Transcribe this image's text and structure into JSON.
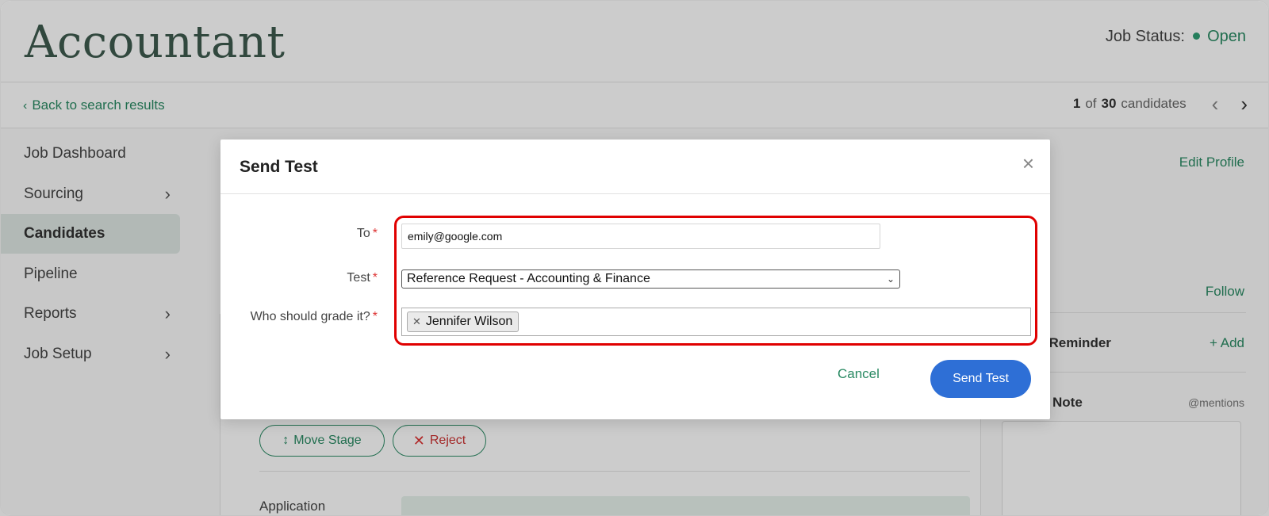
{
  "header": {
    "job_title": "Accountant",
    "status_label": "Job Status:",
    "status_value": "Open"
  },
  "subbar": {
    "back_link": "Back to search results",
    "pager_current": "1",
    "pager_of": "of",
    "pager_total": "30",
    "pager_suffix": "candidates"
  },
  "sidebar": {
    "items": [
      {
        "label": "Job Dashboard"
      },
      {
        "label": "Sourcing"
      },
      {
        "label": "Candidates"
      },
      {
        "label": "Pipeline"
      },
      {
        "label": "Reports"
      },
      {
        "label": "Job Setup"
      }
    ]
  },
  "main": {
    "move_stage": "Move Stage",
    "reject": "Reject",
    "application_label": "Application"
  },
  "right_panel": {
    "edit_profile": "Edit Profile",
    "follow": "Follow",
    "reminder": "up Reminder",
    "add": "+ Add",
    "note": "Note",
    "mentions": "@mentions"
  },
  "modal": {
    "title": "Send Test",
    "to_label": "To",
    "to_value": "emily@google.com",
    "test_label": "Test",
    "test_value": "Reference Request - Accounting & Finance",
    "grade_label": "Who should grade it?",
    "grader_chip": "Jennifer Wilson",
    "required_mark": "*",
    "cancel_label": "Cancel",
    "send_label": "Send Test"
  },
  "colors": {
    "accent_green": "#2a8a63",
    "primary_blue": "#2e6fd6",
    "highlight_red": "#e00000"
  }
}
